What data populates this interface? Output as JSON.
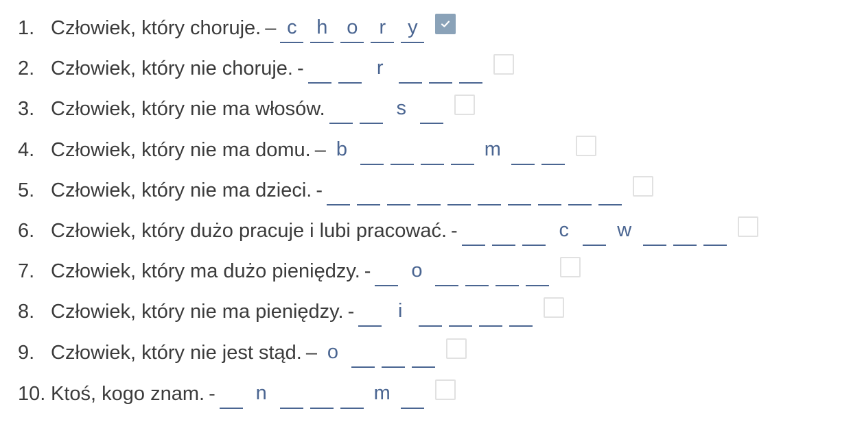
{
  "exercise": {
    "items": [
      {
        "number": "1.",
        "question": "Człowiek, który choruje.",
        "separator": "–",
        "slots": [
          {
            "value": "c",
            "given": false
          },
          {
            "value": "h",
            "given": false
          },
          {
            "value": "o",
            "given": false
          },
          {
            "value": "r",
            "given": false
          },
          {
            "value": "y",
            "given": false
          }
        ],
        "checked": true
      },
      {
        "number": "2.",
        "question": "Człowiek, który nie choruje.",
        "separator": "-",
        "slots": [
          {
            "value": "",
            "given": false
          },
          {
            "value": "",
            "given": false
          },
          {
            "value": "r",
            "given": true
          },
          {
            "value": "",
            "given": false
          },
          {
            "value": "",
            "given": false
          },
          {
            "value": "",
            "given": false
          }
        ],
        "checked": false
      },
      {
        "number": "3.",
        "question": "Człowiek, który nie ma włosów.",
        "separator": "",
        "slots": [
          {
            "value": "",
            "given": false
          },
          {
            "value": "",
            "given": false
          },
          {
            "value": "s",
            "given": true
          },
          {
            "value": "",
            "given": false
          }
        ],
        "checked": false
      },
      {
        "number": "4.",
        "question": "Człowiek, który nie ma domu.",
        "separator": "–",
        "slots": [
          {
            "value": "b",
            "given": true
          },
          {
            "value": "",
            "given": false
          },
          {
            "value": "",
            "given": false
          },
          {
            "value": "",
            "given": false
          },
          {
            "value": "",
            "given": false
          },
          {
            "value": "m",
            "given": true
          },
          {
            "value": "",
            "given": false
          },
          {
            "value": "",
            "given": false
          }
        ],
        "checked": false
      },
      {
        "number": "5.",
        "question": "Człowiek, który nie ma dzieci.",
        "separator": "-",
        "slots": [
          {
            "value": "",
            "given": false
          },
          {
            "value": "",
            "given": false
          },
          {
            "value": "",
            "given": false
          },
          {
            "value": "",
            "given": false
          },
          {
            "value": "",
            "given": false
          },
          {
            "value": "",
            "given": false
          },
          {
            "value": "",
            "given": false
          },
          {
            "value": "",
            "given": false
          },
          {
            "value": "",
            "given": false
          },
          {
            "value": "",
            "given": false
          }
        ],
        "checked": false
      },
      {
        "number": "6.",
        "question": "Człowiek, który dużo pracuje i lubi pracować.",
        "separator": "-",
        "slots": [
          {
            "value": "",
            "given": false
          },
          {
            "value": "",
            "given": false
          },
          {
            "value": "",
            "given": false
          },
          {
            "value": "c",
            "given": true
          },
          {
            "value": "",
            "given": false
          },
          {
            "value": "w",
            "given": true
          },
          {
            "value": "",
            "given": false
          },
          {
            "value": "",
            "given": false
          },
          {
            "value": "",
            "given": false
          }
        ],
        "checked": false
      },
      {
        "number": "7.",
        "question": "Człowiek, który ma dużo pieniędzy.",
        "separator": "-",
        "slots": [
          {
            "value": "",
            "given": false
          },
          {
            "value": "o",
            "given": true
          },
          {
            "value": "",
            "given": false
          },
          {
            "value": "",
            "given": false
          },
          {
            "value": "",
            "given": false
          },
          {
            "value": "",
            "given": false
          }
        ],
        "checked": false
      },
      {
        "number": "8.",
        "question": "Człowiek, który nie ma pieniędzy.",
        "separator": "-",
        "slots": [
          {
            "value": "",
            "given": false
          },
          {
            "value": "i",
            "given": true
          },
          {
            "value": "",
            "given": false
          },
          {
            "value": "",
            "given": false
          },
          {
            "value": "",
            "given": false
          },
          {
            "value": "",
            "given": false
          }
        ],
        "checked": false
      },
      {
        "number": "9.",
        "question": "Człowiek, który nie jest stąd.",
        "separator": "–",
        "slots": [
          {
            "value": "o",
            "given": true
          },
          {
            "value": "",
            "given": false
          },
          {
            "value": "",
            "given": false
          },
          {
            "value": "",
            "given": false
          }
        ],
        "checked": false
      },
      {
        "number": "10.",
        "question": "Ktoś, kogo znam.",
        "separator": "-",
        "slots": [
          {
            "value": "",
            "given": false
          },
          {
            "value": "n",
            "given": true
          },
          {
            "value": "",
            "given": false
          },
          {
            "value": "",
            "given": false
          },
          {
            "value": "",
            "given": false
          },
          {
            "value": "m",
            "given": true
          },
          {
            "value": "",
            "given": false
          }
        ],
        "checked": false
      }
    ],
    "colors": {
      "text": "#3b3b3b",
      "answer": "#4a6591",
      "checkbox_border": "#e1e1e1",
      "checkbox_checked": "#8aa2b8"
    },
    "icons": {
      "checkbox": "checkbox-icon",
      "checkmark": "checkmark-icon"
    }
  }
}
